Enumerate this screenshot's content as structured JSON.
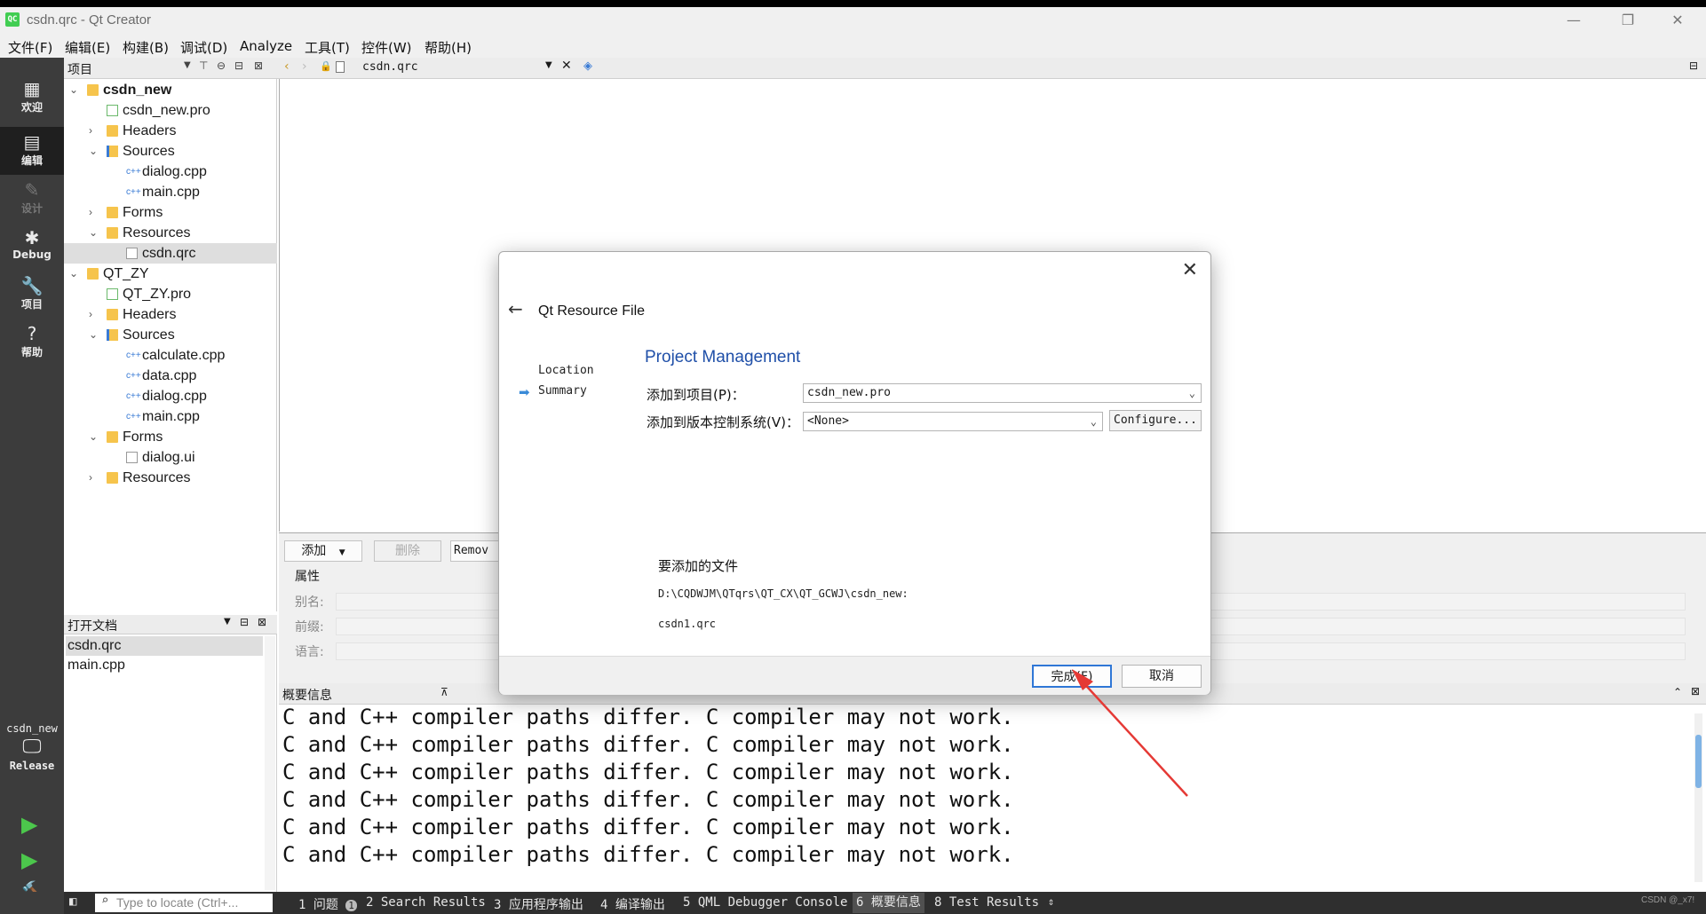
{
  "window": {
    "title": "csdn.qrc - Qt Creator",
    "icon_text": "QC",
    "controls": [
      "—",
      "❐",
      "✕"
    ]
  },
  "menu": [
    "文件(F)",
    "编辑(E)",
    "构建(B)",
    "调试(D)",
    "Analyze",
    "工具(T)",
    "控件(W)",
    "帮助(H)"
  ],
  "modes": [
    {
      "label": "欢迎",
      "icon": "grid-icon"
    },
    {
      "label": "编辑",
      "icon": "edit-icon"
    },
    {
      "label": "设计",
      "icon": "pencil-icon"
    },
    {
      "label": "Debug",
      "icon": "bug-icon"
    },
    {
      "label": "项目",
      "icon": "wrench-icon"
    },
    {
      "label": "帮助",
      "icon": "help-icon"
    }
  ],
  "kit": {
    "project": "csdn_new",
    "config": "Release"
  },
  "sidebar": {
    "title": "项目"
  },
  "tree": [
    {
      "label": "csdn_new",
      "depth": 0,
      "arrow": "v",
      "icon": "folder",
      "bold": true
    },
    {
      "label": "csdn_new.pro",
      "depth": 1,
      "arrow": "",
      "icon": "pro"
    },
    {
      "label": "Headers",
      "depth": 1,
      "arrow": ">",
      "icon": "folder"
    },
    {
      "label": "Sources",
      "depth": 1,
      "arrow": "v",
      "icon": "folder-src"
    },
    {
      "label": "dialog.cpp",
      "depth": 2,
      "arrow": "",
      "icon": "cpp"
    },
    {
      "label": "main.cpp",
      "depth": 2,
      "arrow": "",
      "icon": "cpp"
    },
    {
      "label": "Forms",
      "depth": 1,
      "arrow": ">",
      "icon": "folder"
    },
    {
      "label": "Resources",
      "depth": 1,
      "arrow": "v",
      "icon": "folder"
    },
    {
      "label": "csdn.qrc",
      "depth": 2,
      "arrow": "",
      "icon": "file",
      "selected": true
    },
    {
      "label": "QT_ZY",
      "depth": 0,
      "arrow": "v",
      "icon": "folder"
    },
    {
      "label": "QT_ZY.pro",
      "depth": 1,
      "arrow": "",
      "icon": "pro"
    },
    {
      "label": "Headers",
      "depth": 1,
      "arrow": ">",
      "icon": "folder"
    },
    {
      "label": "Sources",
      "depth": 1,
      "arrow": "v",
      "icon": "folder-src"
    },
    {
      "label": "calculate.cpp",
      "depth": 2,
      "arrow": "",
      "icon": "cpp"
    },
    {
      "label": "data.cpp",
      "depth": 2,
      "arrow": "",
      "icon": "cpp"
    },
    {
      "label": "dialog.cpp",
      "depth": 2,
      "arrow": "",
      "icon": "cpp"
    },
    {
      "label": "main.cpp",
      "depth": 2,
      "arrow": "",
      "icon": "cpp"
    },
    {
      "label": "Forms",
      "depth": 1,
      "arrow": "v",
      "icon": "folder"
    },
    {
      "label": "dialog.ui",
      "depth": 2,
      "arrow": "",
      "icon": "file"
    },
    {
      "label": "Resources",
      "depth": 1,
      "arrow": ">",
      "icon": "folder"
    }
  ],
  "open_docs": {
    "title": "打开文档",
    "items": [
      {
        "label": "csdn.qrc",
        "selected": true
      },
      {
        "label": "main.cpp"
      }
    ]
  },
  "editor": {
    "file_tab": "csdn.qrc"
  },
  "resource_editor": {
    "add": "添加",
    "delete": "删除",
    "remove": "Remov",
    "properties": "属性",
    "alias": "别名:",
    "prefix": "前缀:",
    "language": "语言:"
  },
  "output": {
    "title": "概要信息",
    "lines": [
      "C and C++ compiler paths differ. C compiler may not work.",
      "C and C++ compiler paths differ. C compiler may not work.",
      "C and C++ compiler paths differ. C compiler may not work.",
      "C and C++ compiler paths differ. C compiler may not work.",
      "C and C++ compiler paths differ. C compiler may not work.",
      "C and C++ compiler paths differ. C compiler may not work."
    ]
  },
  "statusbar": {
    "locator_placeholder": "Type to locate (Ctrl+...",
    "tabs": [
      {
        "label": "1 问题",
        "badge": "1"
      },
      {
        "label": "2 Search Results"
      },
      {
        "label": "3 应用程序输出"
      },
      {
        "label": "4 编译输出"
      },
      {
        "label": "5 QML Debugger Console"
      },
      {
        "label": "6 概要信息",
        "active": true
      },
      {
        "label": "8 Test Results"
      }
    ],
    "watermark": "CSDN @_x7!"
  },
  "dialog": {
    "title": "Qt Resource File",
    "steps": [
      "Location",
      "Summary"
    ],
    "current_step": "Summary",
    "heading": "Project Management",
    "add_to_project_label": "添加到项目(P)：",
    "add_to_project_value": "csdn_new.pro",
    "vcs_label": "添加到版本控制系统(V)：",
    "vcs_value": "<None>",
    "configure": "Configure...",
    "files_label": "要添加的文件",
    "files_path": "D:\\CQDWJM\\QTqrs\\QT_CX\\QT_GCWJ\\csdn_new:",
    "files_name": "csdn1.qrc",
    "finish": "完成(F)",
    "cancel": "取消"
  },
  "colors": {
    "accent": "#1f4fa8",
    "primary_border": "#2f77d6",
    "annotation_arrow": "#e53935"
  }
}
